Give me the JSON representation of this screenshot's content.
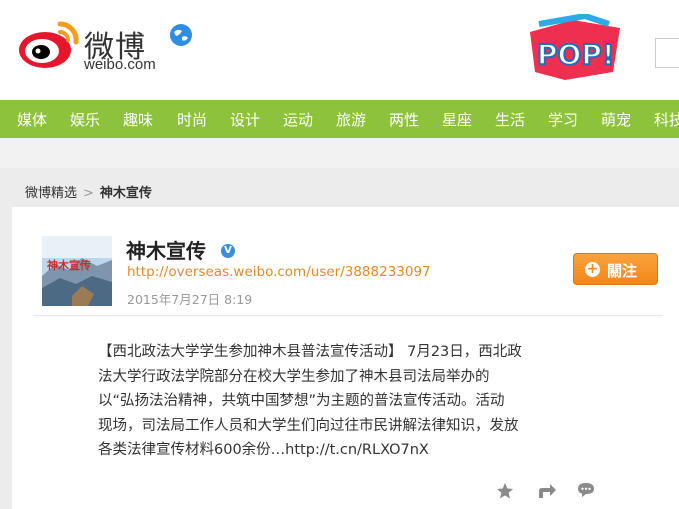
{
  "header": {
    "logo_text": "微博",
    "logo_sub": "weibo.com",
    "promo": "POP!"
  },
  "nav": [
    {
      "label": "媒体"
    },
    {
      "label": "娱乐"
    },
    {
      "label": "趣味"
    },
    {
      "label": "时尚"
    },
    {
      "label": "设计"
    },
    {
      "label": "运动"
    },
    {
      "label": "旅游"
    },
    {
      "label": "两性"
    },
    {
      "label": "星座"
    },
    {
      "label": "生活"
    },
    {
      "label": "学习"
    },
    {
      "label": "萌宠"
    },
    {
      "label": "科技"
    }
  ],
  "breadcrumb": {
    "root": "微博精选",
    "sep": ">",
    "current": "神木宣传"
  },
  "profile": {
    "name": "神木宣传",
    "url": "http://overseas.weibo.com/user/3888233097",
    "date": "2015年7月27日 8:19",
    "follow_label": "關注",
    "avatar_caption": "神木宣传"
  },
  "post": {
    "lines": [
      "【西北政法大学学生参加神木县普法宣传活动】 7月23日，西北政",
      "法大学行政法学院部分在校大学生参加了神木县司法局举办的",
      "以“弘扬法治精神，共筑中国梦想”为主题的普法宣传活动。活动",
      "现场，司法局工作人员和大学生们向过往市民讲解法律知识，发放",
      "各类法律宣传材料600余份…http://t.cn/RLXO7nX"
    ]
  },
  "colors": {
    "nav_bg": "#8dc23b",
    "follow_bg": "#f7941d",
    "url_color": "#e38a2c"
  },
  "icons": [
    "favorite-icon",
    "repost-icon",
    "comment-icon"
  ]
}
